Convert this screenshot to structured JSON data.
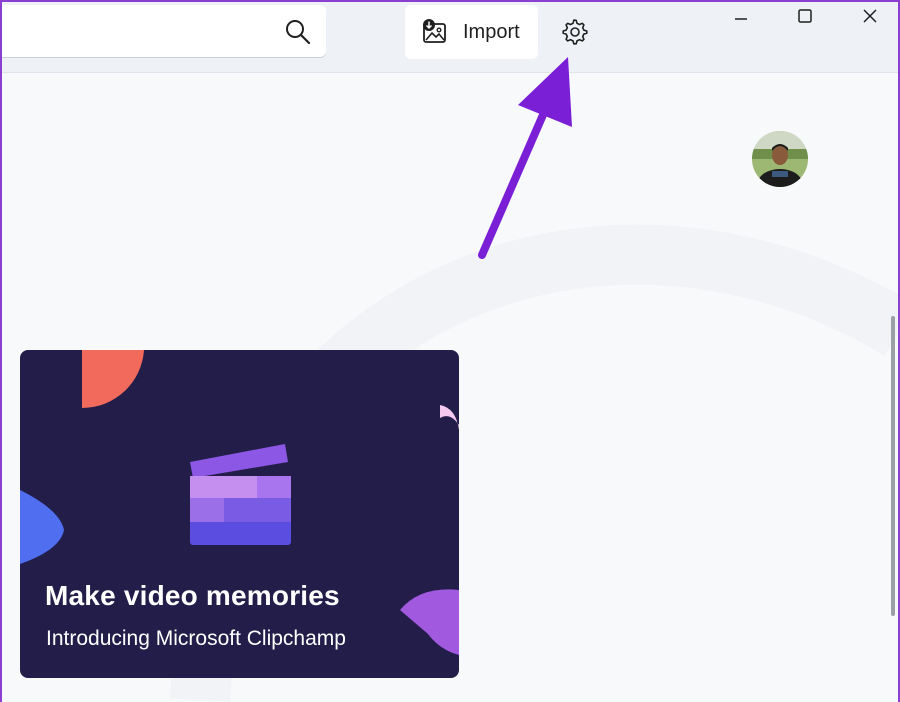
{
  "search": {
    "value": "",
    "placeholder": ""
  },
  "toolbar": {
    "import_label": "Import"
  },
  "card": {
    "title": "Make video memories",
    "subtitle": "Introducing Microsoft Clipchamp"
  },
  "colors": {
    "annotation_arrow": "#7b1fd6",
    "card_background": "#231d4a",
    "window_border": "#8a3fd1"
  }
}
